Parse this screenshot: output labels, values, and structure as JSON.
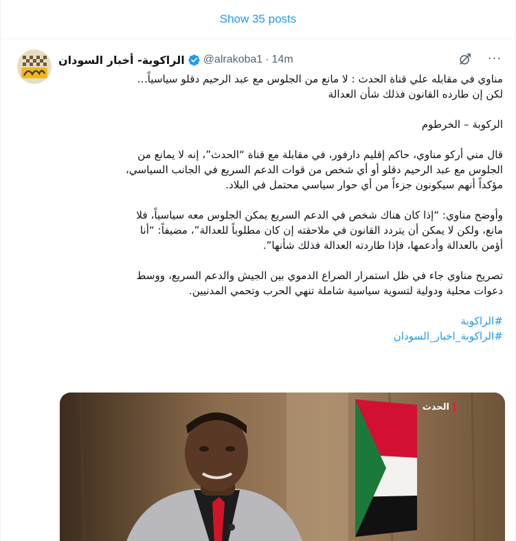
{
  "timeline": {
    "show_posts_label": "Show 35 posts"
  },
  "tweet": {
    "author": {
      "display_name": "الراكوبة- أخبار السودان",
      "handle": "@alrakoba1",
      "verified": true,
      "avatar_icon": "alrakoba-logo-avatar"
    },
    "separator": "·",
    "time": "14m",
    "actions": {
      "mute_icon": "mute-icon",
      "more_label": "···"
    },
    "text": {
      "headline_1": "مناوي في مقابله علي قناة  الحدث : لا مانع من الجلوس مع عبد الرحيم دقلو سياسياً…",
      "headline_2": "لكن إن طارده القانون فذلك شأن العدالة",
      "dateline": "الركوبة – الخرطوم",
      "para1_l1": "قال مني أركو مناوي، حاكم إقليم دارفور، في مقابلة مع قناة “الحدث”، إنه لا يمانع من",
      "para1_l2": "الجلوس مع عبد الرحيم دقلو أو أي شخص من قوات الدعم السريع في الجانب السياسي،",
      "para1_l3": "مؤكداً أنهم سيكونون جزءاً من أي حوار سياسي محتمل في البلاد.",
      "para2_l1": "وأوضح مناوي: “إذا كان هناك شخص في الدعم السريع يمكن الجلوس معه سياسياً، فلا",
      "para2_l2": "مانع، ولكن لا يمكن أن يتردد القانون في ملاحقته إن كان مطلوباً للعدالة”، مضيفاً: “أنا",
      "para2_l3": "أؤمن بالعدالة وأدعمها، فإذا طاردته العدالة فذلك شأنها”.",
      "para3_l1": "تصريح مناوي جاء في ظل استمرار الصراع الدموي بين الجيش والدعم السريع، ووسط",
      "para3_l2": "دعوات محلية ودولية لتسوية سياسية شاملة تنهي الحرب وتحمي المدنيين."
    },
    "hashtags": [
      "#الراكوبة",
      "#الراكوبة_اخبار_السودان"
    ],
    "media": {
      "watermark": "الحدث",
      "colors": {
        "flag_red": "#d21034",
        "flag_white": "#f4f2ee",
        "flag_black": "#111111",
        "flag_green": "#1a7a3a",
        "background": "#7a6149",
        "jacket": "#b8b8bd",
        "shirt": "#1c1c1c",
        "tie": "#d0152a"
      }
    }
  }
}
